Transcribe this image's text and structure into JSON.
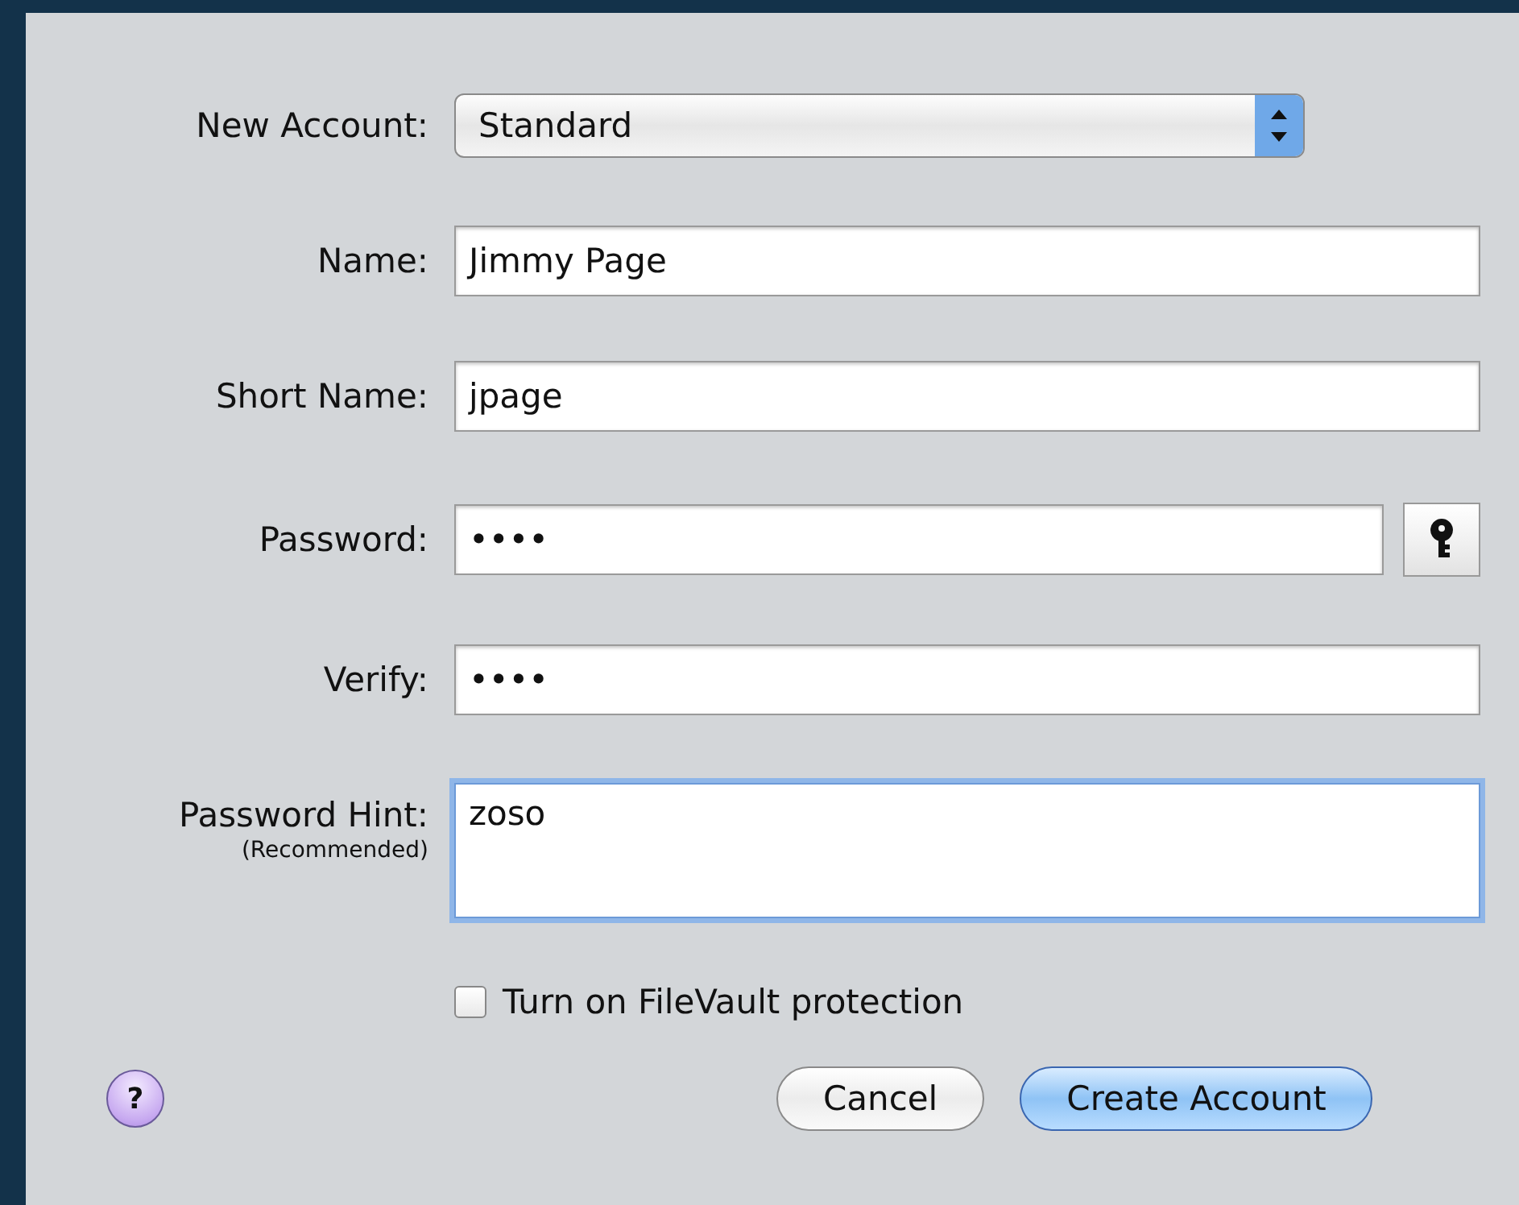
{
  "account_type": {
    "label": "New Account:",
    "value": "Standard"
  },
  "fields": [
    {
      "label": "Name:",
      "value": "Jimmy Page",
      "kind": "text",
      "focused": false
    },
    {
      "label": "Short Name:",
      "value": "jpage",
      "kind": "text",
      "focused": false
    },
    {
      "label": "Password:",
      "value": "••••",
      "kind": "password",
      "focused": false
    },
    {
      "label": "Verify:",
      "value": "••••",
      "kind": "text",
      "focused": false
    },
    {
      "label": "Password Hint:",
      "sublabel": "(Recommended)",
      "value": "zoso",
      "kind": "multiline",
      "focused": true
    }
  ],
  "filevault": {
    "label": "Turn on FileVault protection",
    "checked": false
  },
  "help": {
    "label": "?"
  },
  "buttons": [
    {
      "label": "Cancel",
      "default": false
    },
    {
      "label": "Create Account",
      "default": true
    }
  ]
}
